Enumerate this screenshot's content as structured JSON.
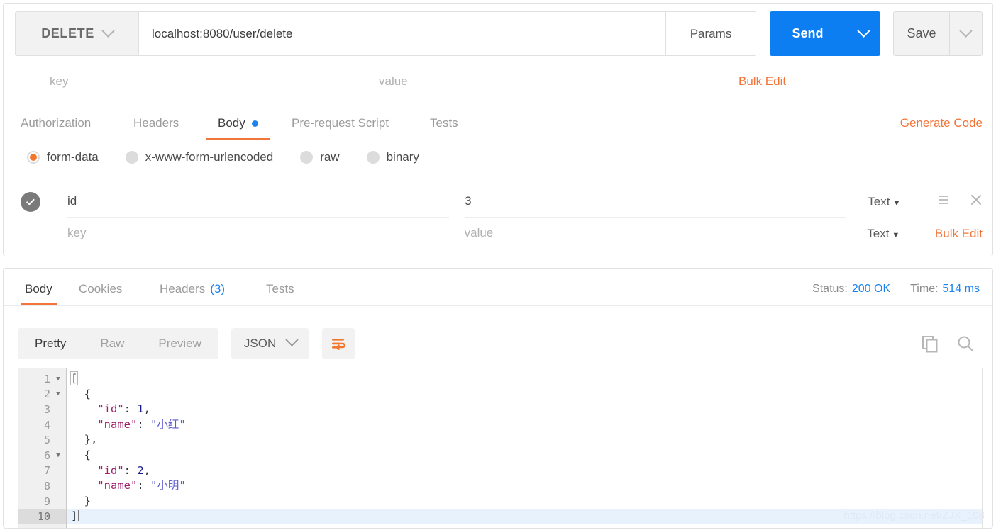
{
  "request": {
    "method": "DELETE",
    "url": "localhost:8080/user/delete",
    "params_button": "Params",
    "send_button": "Send",
    "save_button": "Save",
    "query_params": {
      "key_placeholder": "key",
      "value_placeholder": "value",
      "bulk_edit": "Bulk Edit"
    },
    "tabs": [
      {
        "label": "Authorization",
        "active": false,
        "dot": false
      },
      {
        "label": "Headers",
        "active": false,
        "dot": false
      },
      {
        "label": "Body",
        "active": true,
        "dot": true
      },
      {
        "label": "Pre-request Script",
        "active": false,
        "dot": false
      },
      {
        "label": "Tests",
        "active": false,
        "dot": false
      }
    ],
    "generate_code": "Generate Code",
    "body_types": [
      {
        "label": "form-data",
        "selected": true
      },
      {
        "label": "x-www-form-urlencoded",
        "selected": false
      },
      {
        "label": "raw",
        "selected": false
      },
      {
        "label": "binary",
        "selected": false
      }
    ],
    "form_data": {
      "rows": [
        {
          "checked": true,
          "key": "id",
          "value": "3",
          "type": "Text",
          "has_menu_icon": true,
          "has_remove_icon": true
        }
      ],
      "empty_row": {
        "key_placeholder": "key",
        "value_placeholder": "value",
        "type": "Text",
        "bulk_edit": "Bulk Edit"
      }
    }
  },
  "response": {
    "tabs": [
      {
        "label": "Body",
        "active": true,
        "count": ""
      },
      {
        "label": "Cookies",
        "active": false,
        "count": ""
      },
      {
        "label": "Headers",
        "active": false,
        "count": "(3)"
      },
      {
        "label": "Tests",
        "active": false,
        "count": ""
      }
    ],
    "status_label": "Status:",
    "status_value": "200 OK",
    "time_label": "Time:",
    "time_value": "514 ms",
    "view_modes": [
      {
        "label": "Pretty",
        "active": true
      },
      {
        "label": "Raw",
        "active": false
      },
      {
        "label": "Preview",
        "active": false
      }
    ],
    "language": "JSON",
    "body_lines": [
      {
        "n": "1",
        "fold": true,
        "active": false,
        "tokens": [
          {
            "t": "punc",
            "v": "["
          }
        ]
      },
      {
        "n": "2",
        "fold": true,
        "active": false,
        "tokens": [
          {
            "t": "punc",
            "v": "  {"
          }
        ]
      },
      {
        "n": "3",
        "fold": false,
        "active": false,
        "tokens": [
          {
            "t": "key",
            "v": "    \"id\""
          },
          {
            "t": "punc",
            "v": ": "
          },
          {
            "t": "num",
            "v": "1"
          },
          {
            "t": "punc",
            "v": ","
          }
        ]
      },
      {
        "n": "4",
        "fold": false,
        "active": false,
        "tokens": [
          {
            "t": "key",
            "v": "    \"name\""
          },
          {
            "t": "punc",
            "v": ": "
          },
          {
            "t": "str",
            "v": "\"小红\""
          }
        ]
      },
      {
        "n": "5",
        "fold": false,
        "active": false,
        "tokens": [
          {
            "t": "punc",
            "v": "  },"
          }
        ]
      },
      {
        "n": "6",
        "fold": true,
        "active": false,
        "tokens": [
          {
            "t": "punc",
            "v": "  {"
          }
        ]
      },
      {
        "n": "7",
        "fold": false,
        "active": false,
        "tokens": [
          {
            "t": "key",
            "v": "    \"id\""
          },
          {
            "t": "punc",
            "v": ": "
          },
          {
            "t": "num",
            "v": "2"
          },
          {
            "t": "punc",
            "v": ","
          }
        ]
      },
      {
        "n": "8",
        "fold": false,
        "active": false,
        "tokens": [
          {
            "t": "key",
            "v": "    \"name\""
          },
          {
            "t": "punc",
            "v": ": "
          },
          {
            "t": "str",
            "v": "\"小明\""
          }
        ]
      },
      {
        "n": "9",
        "fold": false,
        "active": false,
        "tokens": [
          {
            "t": "punc",
            "v": "  }"
          }
        ]
      },
      {
        "n": "10",
        "fold": false,
        "active": true,
        "tokens": [
          {
            "t": "punc",
            "v": "]"
          }
        ]
      }
    ]
  },
  "watermark": "https://blog.csdn.net/ZJX_108",
  "colors": {
    "accent_orange": "#f2763a",
    "primary_blue": "#0d7ef2",
    "link_blue": "#1b84ee",
    "json_key": "#a11f6b",
    "json_string": "#5c5ccc",
    "json_number": "#1a1a8c"
  }
}
